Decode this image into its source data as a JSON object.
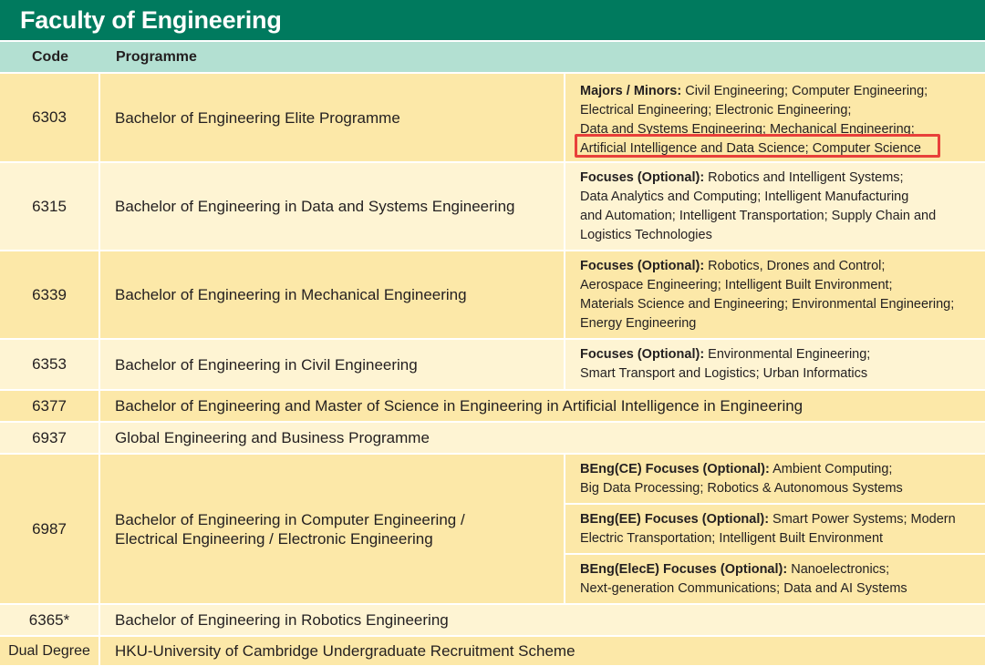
{
  "faculty_title": "Faculty of Engineering",
  "headers": {
    "code": "Code",
    "programme": "Programme"
  },
  "rows": [
    {
      "code": "6303",
      "programme": "Bachelor of Engineering Elite Programme",
      "note_label": "Majors / Minors:",
      "note_text": " Civil Engineering; Computer Engineering;",
      "note_lines": [
        "Electrical Engineering; Electronic Engineering;",
        "Data and Systems Engineering; Mechanical Engineering;"
      ],
      "highlighted_line": "Artificial Intelligence and Data Science; Computer Science"
    },
    {
      "code": "6315",
      "programme": "Bachelor of Engineering in Data and Systems Engineering",
      "note_label": "Focuses (Optional):",
      "note_text": " Robotics and Intelligent Systems;",
      "note_lines": [
        "Data Analytics and Computing; Intelligent Manufacturing",
        "and Automation; Intelligent Transportation; Supply Chain and",
        "Logistics Technologies"
      ]
    },
    {
      "code": "6339",
      "programme": "Bachelor of Engineering in Mechanical Engineering",
      "note_label": "Focuses (Optional):",
      "note_text": " Robotics, Drones and Control;",
      "note_lines": [
        "Aerospace Engineering; Intelligent Built Environment;",
        "Materials Science and Engineering; Environmental Engineering;",
        "Energy Engineering"
      ]
    },
    {
      "code": "6353",
      "programme": "Bachelor of Engineering in Civil Engineering",
      "note_label": "Focuses (Optional):",
      "note_text": " Environmental Engineering;",
      "note_lines": [
        "Smart Transport and Logistics; Urban Informatics"
      ]
    },
    {
      "code": "6377",
      "programme": "Bachelor of Engineering and Master of Science in Engineering in Artificial Intelligence in Engineering"
    },
    {
      "code": "6937",
      "programme": "Global Engineering and Business Programme"
    },
    {
      "code": "6987",
      "programme_lines": [
        "Bachelor of Engineering in Computer Engineering /",
        "Electrical Engineering / Electronic Engineering"
      ],
      "sub_notes": [
        {
          "label": "BEng(CE) Focuses (Optional):",
          "text": " Ambient Computing;",
          "line2": "Big Data Processing; Robotics & Autonomous Systems"
        },
        {
          "label": "BEng(EE) Focuses (Optional):",
          "text": " Smart Power Systems; Modern",
          "line2": "Electric Transportation; Intelligent Built Environment"
        },
        {
          "label": "BEng(ElecE) Focuses (Optional):",
          "text": " Nanoelectronics;",
          "line2": "Next-generation Communications; Data and AI Systems"
        }
      ]
    },
    {
      "code": "6365*",
      "programme": "Bachelor of Engineering in Robotics Engineering"
    },
    {
      "code": "Dual Degree",
      "programme": "HKU-University of Cambridge Undergraduate Recruitment Scheme"
    }
  ],
  "colors": {
    "title_bar": "#007a5e",
    "header_row": "#b3e0d2",
    "row_dark": "#fce8a8",
    "row_light": "#fef4d3",
    "highlight": "#e8403a"
  }
}
